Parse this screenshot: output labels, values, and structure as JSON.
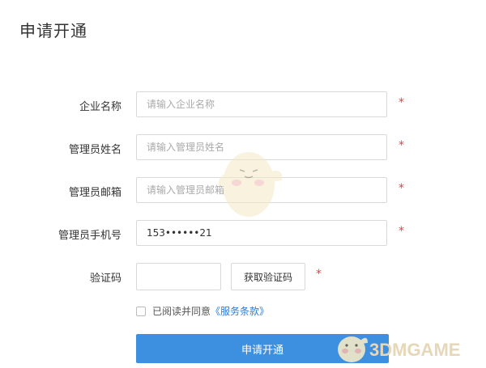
{
  "page": {
    "title": "申请开通"
  },
  "form": {
    "company_name": {
      "label": "企业名称",
      "placeholder": "请输入企业名称",
      "value": "",
      "required_mark": "*"
    },
    "admin_name": {
      "label": "管理员姓名",
      "placeholder": "请输入管理员姓名",
      "value": "",
      "required_mark": "*"
    },
    "admin_email": {
      "label": "管理员邮箱",
      "placeholder": "请输入管理员邮箱",
      "value": "",
      "required_mark": "*"
    },
    "admin_phone": {
      "label": "管理员手机号",
      "placeholder": "",
      "value": "153••••••21",
      "required_mark": "*"
    },
    "verification": {
      "label": "验证码",
      "value": "",
      "button_label": "获取验证码",
      "required_mark": "*"
    },
    "agreement": {
      "text": "已阅读并同意",
      "link_text": "《服务条款》",
      "checked": false
    },
    "submit_label": "申请开通"
  },
  "watermark": {
    "text": "3DMGAME"
  },
  "colors": {
    "primary": "#3d8fe0",
    "required": "#e64340",
    "link": "#2b7bd6",
    "border": "#d9d9d9"
  }
}
